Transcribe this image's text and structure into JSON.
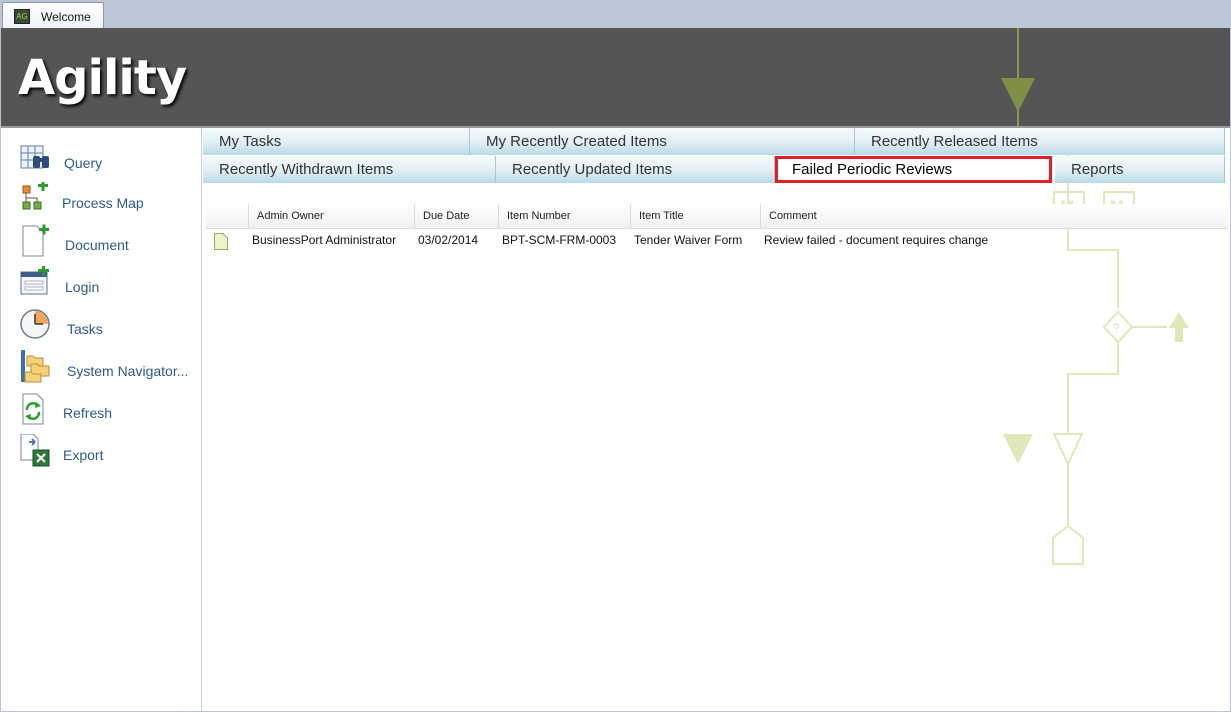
{
  "window": {
    "tab_label": "Welcome",
    "app_icon_text": "AG"
  },
  "header": {
    "brand": "Agility"
  },
  "nav": {
    "items": [
      {
        "label": "Query",
        "icon": "binoculars-grid-icon"
      },
      {
        "label": "Process Map",
        "icon": "process-map-add-icon"
      },
      {
        "label": "Document",
        "icon": "document-add-icon"
      },
      {
        "label": "Login",
        "icon": "login-form-add-icon"
      },
      {
        "label": "Tasks",
        "icon": "clock-icon"
      },
      {
        "label": "System Navigator...",
        "icon": "folders-icon"
      },
      {
        "label": "Refresh",
        "icon": "refresh-document-icon"
      },
      {
        "label": "Export",
        "icon": "excel-export-icon"
      }
    ]
  },
  "tabs": {
    "row1": [
      "My Tasks",
      "My Recently Created Items",
      "Recently Released Items"
    ],
    "row2": [
      "Recently Withdrawn Items",
      "Recently Updated Items",
      "Failed Periodic Reviews",
      "Reports"
    ],
    "active": "Failed Periodic Reviews"
  },
  "grid": {
    "columns": [
      "Admin Owner",
      "Due Date",
      "Item Number",
      "Item Title",
      "Comment"
    ],
    "rows": [
      {
        "admin_owner": "BusinessPort Administrator",
        "due_date": "03/02/2014",
        "item_number": "BPT-SCM-FRM-0003",
        "item_title": "Tender Waiver Form",
        "comment": "Review failed - document requires change"
      }
    ]
  },
  "decoration": {
    "marker_label": "M",
    "decision_label": "?"
  },
  "colors": {
    "header_bg": "#555555",
    "nav_text": "#2e5a8a",
    "active_tab_border": "#e21e26",
    "tab_gradient_bottom": "#b9d9e6",
    "decoration": "#dfe8b8"
  }
}
